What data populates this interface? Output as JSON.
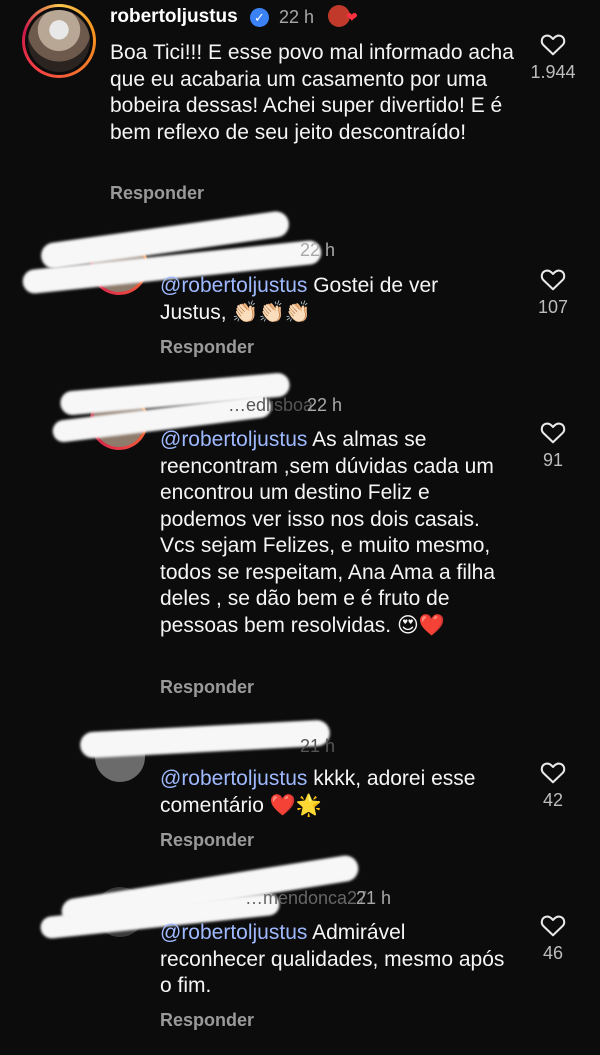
{
  "main_comment": {
    "username": "robertoljustus",
    "time": "22 h",
    "text": "Boa Tici!!! E esse povo mal informado acha que eu acabaria um casamento por uma bobeira dessas! Achei super divertido! E é bem reflexo de seu jeito descontraído!",
    "reply": "Responder",
    "likes": "1.944"
  },
  "replies": [
    {
      "time": "22 h",
      "mention": "@robertoljustus",
      "text": " Gostei de ver Justus, 👏🏻👏🏻👏🏻",
      "reply": "Responder",
      "likes": "107"
    },
    {
      "username_visible": "…edlisboa",
      "time": "22 h",
      "mention": "@robertoljustus",
      "text": " As almas se reencontram ,sem dúvidas cada um encontrou um destino Feliz e podemos ver isso nos dois casais. Vcs sejam Felizes, e muito mesmo, todos se respeitam,  Ana Ama a filha deles , se dão bem e é fruto de pessoas bem resolvidas. 😍❤️",
      "reply": "Responder",
      "likes": "91"
    },
    {
      "time": "21 h",
      "mention": "@robertoljustus",
      "text": " kkkk, adorei esse comentário ❤️🌟",
      "reply": "Responder",
      "likes": "42"
    },
    {
      "username_visible": "…mendonca27",
      "time": "21 h",
      "mention": "@robertoljustus",
      "text": " Admirável reconhecer qualidades, mesmo após o fim.",
      "reply": "Responder",
      "likes": "46"
    }
  ],
  "colors": {
    "background": "#0c0c0c",
    "mention": "#9fb9ff",
    "verified": "#3b82f6",
    "secondary_text": "#9a9a9a"
  },
  "icons": {
    "like": "heart-outline-icon",
    "verified": "verified-badge-icon"
  }
}
